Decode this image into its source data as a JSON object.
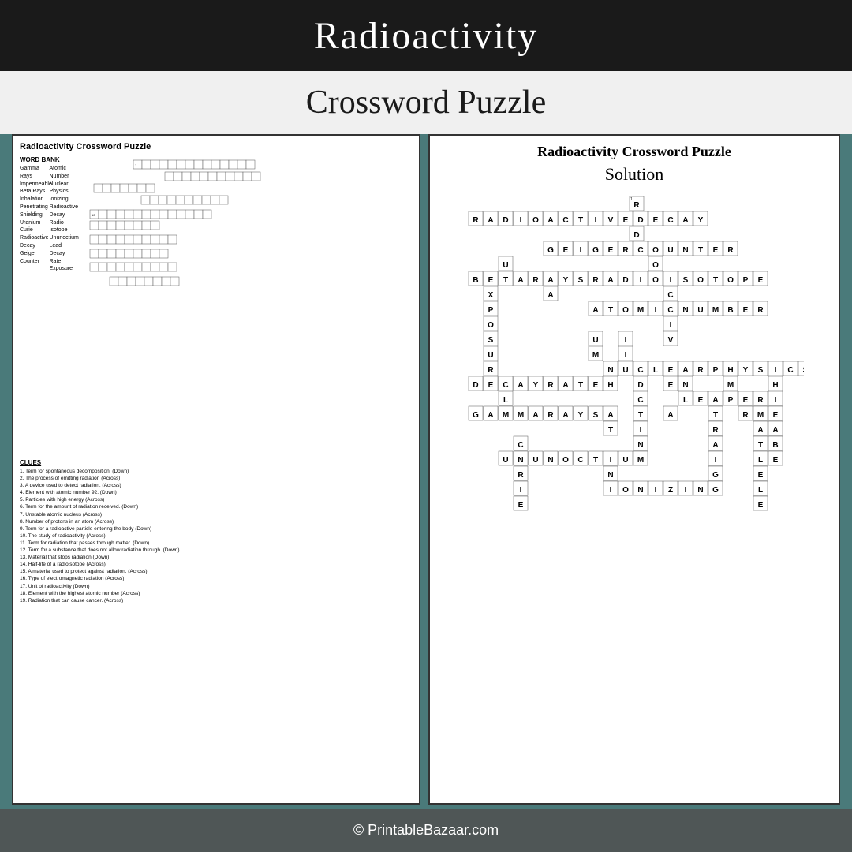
{
  "header": {
    "top_title": "Radioactivity",
    "subtitle": "Crossword Puzzle"
  },
  "footer": {
    "text": "© PrintableBazaar.com"
  },
  "left_panel": {
    "title": "Radioactivity Crossword Puzzle",
    "word_bank_label": "WORD BANK",
    "word_bank": [
      "Gamma Rays",
      "Impermeable",
      "Beta Rays",
      "Inhalation",
      "Penetrating",
      "Shielding",
      "Uranium",
      "Curie",
      "Radioactive Decay",
      "Geiger Counter",
      "Atomic Number",
      "Nuclear Physics",
      "Ionizing",
      "Radioactive Decay",
      "Radio Isotope",
      "Ununoctium",
      "Lead",
      "Decay Rate",
      "Exposure"
    ],
    "clues_label": "CLUES",
    "clues": [
      "1. Term for spontaneous decomposition. (Down)",
      "2. The process of emitting radiation (Across)",
      "3. A device used to detect radiation. (Across)",
      "4. Element with atomic number 92. (Down)",
      "5. Particles with high energy (Across)",
      "6. Term for the amount of radiation received. (Down)",
      "7. Unstable atomic nucleus (Across)",
      "8. Number of protons in an atom (Across)",
      "9. Term for a radioactive particle entering the body (Down)",
      "10. The study of radioactivity (Across)",
      "11. Term for radiation that passes through matter. (Down)",
      "12. Term for a substance that does not allow radiation through. (Down)",
      "13. Material that stops radiation (Down)",
      "14. Half-life of a radioisotope (Across)",
      "15. A material used to protect against radiation. (Across)",
      "16. Type of electromagnetic radiation (Across)",
      "17. Unit of radioactivity (Down)",
      "18. Element with the highest atomic number (Across)",
      "19. Radiation that can cause cancer. (Across)"
    ]
  },
  "right_panel": {
    "title": "Radioactivity Crossword Puzzle",
    "solution_label": "Solution"
  }
}
